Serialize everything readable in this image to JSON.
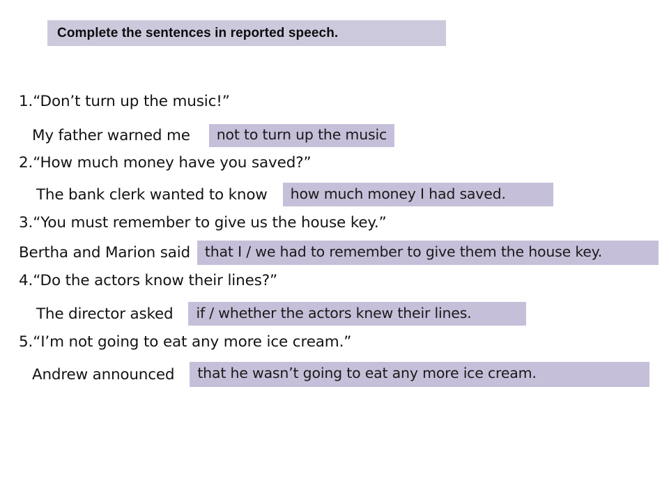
{
  "title": {
    "text": "Complete the sentences in reported speech.",
    "background": "#cdc9dd"
  },
  "styles": {
    "answer_box_background": "#c6bfd9",
    "text_color": "#131313"
  },
  "items": [
    {
      "number": "1.",
      "quote": "1.“Don’t turn up the music!”",
      "lead_in": "My father warned me",
      "answer": "not to turn up the music"
    },
    {
      "number": "2.",
      "quote": "2.“How much money have you saved?”",
      "lead_in": "The bank clerk wanted to know",
      "answer": "how much money I had saved."
    },
    {
      "number": "3.",
      "quote": "3.“You must remember to give us the house key.”",
      "lead_in": "Bertha and Marion said",
      "answer": "that I / we had to remember to give them the house key."
    },
    {
      "number": "4.",
      "quote": "4.“Do the actors know their lines?”",
      "lead_in": "The director asked",
      "answer": "if / whether the actors knew their lines."
    },
    {
      "number": "5.",
      "quote": "5.“I’m not going to eat any more ice cream.”",
      "lead_in": "Andrew announced",
      "answer": "that he wasn’t going to eat any more ice cream."
    }
  ]
}
